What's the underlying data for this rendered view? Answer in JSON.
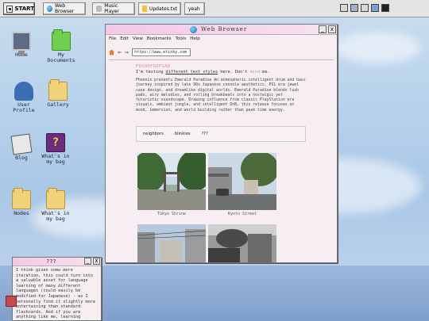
{
  "taskbar": {
    "start": "START",
    "tasks": [
      {
        "label": "Web Browser",
        "icon": "globe-icon"
      },
      {
        "label": "Music Player",
        "icon": "music-icon"
      },
      {
        "label": "Updates.txt",
        "icon": "note-icon"
      },
      {
        "label": "yeah",
        "icon": "window-icon"
      }
    ],
    "tray": [
      "printer-icon",
      "volume-icon",
      "disk-icon",
      "pen-icon",
      "terminal-icon"
    ]
  },
  "desktop": {
    "icons": [
      {
        "label": "Home",
        "icon": "monitor-icon"
      },
      {
        "label": "My Documents",
        "icon": "green-folder-icon"
      },
      {
        "label": "User Profile",
        "icon": "user-icon"
      },
      {
        "label": "Gallery",
        "icon": "folder-icon"
      },
      {
        "label": "Blog",
        "icon": "newspaper-icon"
      },
      {
        "label": "What's in my bag",
        "icon": "help-book-icon"
      },
      {
        "label": "Nodes",
        "icon": "folder-icon"
      },
      {
        "label": "What's in my bag",
        "icon": "folder-icon"
      }
    ]
  },
  "browser": {
    "title": "Web Browser",
    "menu": [
      "File",
      "Edit",
      "View",
      "Bookmarks",
      "Tools",
      "Help"
    ],
    "url": "https://www.etinky.com",
    "site_title": "FDGHDFGDFGAD",
    "tagline_pre": "I'm testing ",
    "tagline_link": "different text styles",
    "tagline_mid": " here. Don't ",
    "tagline_pink": "mind",
    "tagline_post": " me.",
    "paragraph": "Phoenix presents Emerald Paradise An atmospheric intelligent drum and bass journey inspired by late 90s Japanese console aesthetics, PS1 era jewel case design, and dreamlike digital worlds. Emerald Paradise blends lush pads, airy melodies, and rolling breakbeats into a nostalgic yet futuristic soundscape. Drawing influence from classic PlayStation era visuals, ambient jungle, and intelligent DnB, this release focuses on mood, immersion, and world building rather than peak time energy.",
    "nav": [
      "neighbors",
      "blinkies",
      "???"
    ],
    "photos": [
      {
        "caption": "Tokyo Shrine"
      },
      {
        "caption": "Kyoto Street"
      },
      {
        "caption": ""
      },
      {
        "caption": ""
      }
    ]
  },
  "note": {
    "title": "???",
    "text": "I think given some more iteration, this could turn into a valuable asset for language learning of many different languages (could easily be modified for Japanese) - as I personally find it slightly more entertaining than standard flashcards. And if you are anything like me, learning something is more about staying"
  }
}
